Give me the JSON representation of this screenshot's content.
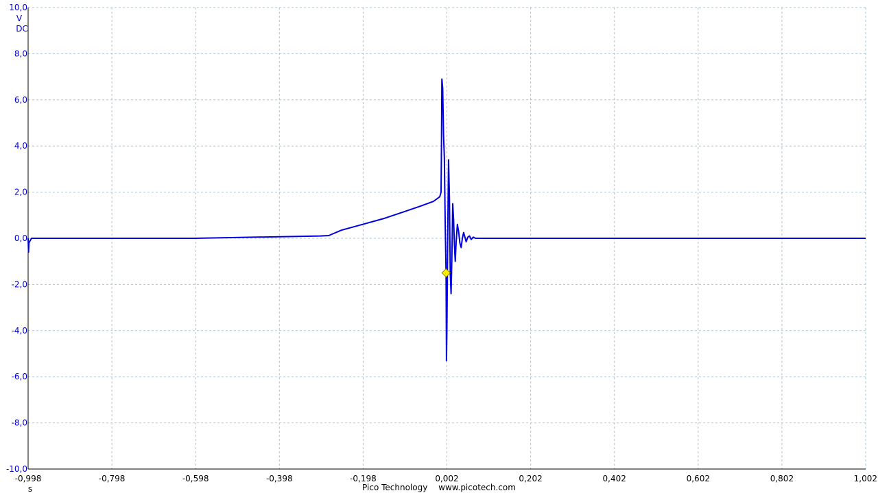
{
  "chart_data": {
    "type": "line",
    "y_unit": "V",
    "y_coupling": "DC",
    "x_unit": "s",
    "xlim": [
      -0.998,
      1.002
    ],
    "ylim": [
      -10.0,
      10.0
    ],
    "x_ticks": [
      "-0,998",
      "-0,798",
      "-0,598",
      "-0,398",
      "-0,198",
      "0,002",
      "0,202",
      "0,402",
      "0,602",
      "0,802",
      "1,002"
    ],
    "y_ticks": [
      "10,0",
      "8,0",
      "6,0",
      "4,0",
      "2,0",
      "0,0",
      "-2,0",
      "-4,0",
      "-6,0",
      "-8,0",
      "-10,0"
    ],
    "grid": true,
    "trigger_marker": {
      "x": 0.0,
      "y": -1.5
    },
    "series": [
      {
        "color": "#0000dd",
        "x": [
          -0.998,
          -0.997,
          -0.996,
          -0.99,
          -0.8,
          -0.6,
          -0.45,
          -0.3,
          -0.28,
          -0.25,
          -0.2,
          -0.15,
          -0.1,
          -0.06,
          -0.03,
          -0.015,
          -0.012,
          -0.011,
          -0.01,
          -0.008,
          -0.006,
          -0.004,
          -0.002,
          0.0,
          0.001,
          0.002,
          0.004,
          0.006,
          0.008,
          0.01,
          0.012,
          0.014,
          0.016,
          0.018,
          0.02,
          0.022,
          0.024,
          0.027,
          0.03,
          0.033,
          0.036,
          0.039,
          0.042,
          0.045,
          0.048,
          0.052,
          0.056,
          0.06,
          0.065,
          0.07,
          0.08,
          0.1,
          0.3,
          0.6,
          1.002
        ],
        "y": [
          0.0,
          -0.6,
          -0.2,
          0.0,
          0.0,
          0.0,
          0.05,
          0.1,
          0.12,
          0.35,
          0.6,
          0.85,
          1.15,
          1.4,
          1.6,
          1.8,
          2.0,
          4.0,
          6.9,
          6.5,
          4.5,
          3.5,
          0.5,
          -1.5,
          -5.3,
          -4.0,
          0.0,
          3.4,
          1.8,
          -1.5,
          -2.4,
          -0.8,
          1.5,
          0.8,
          -0.3,
          -1.0,
          -0.2,
          0.6,
          0.3,
          -0.2,
          -0.4,
          0.0,
          0.25,
          0.05,
          -0.15,
          0.05,
          0.1,
          -0.05,
          0.05,
          0.0,
          0.0,
          0.0,
          0.0,
          0.0,
          0.0
        ]
      }
    ]
  },
  "footer": {
    "company": "Pico Technology",
    "url": "www.picotech.com"
  }
}
